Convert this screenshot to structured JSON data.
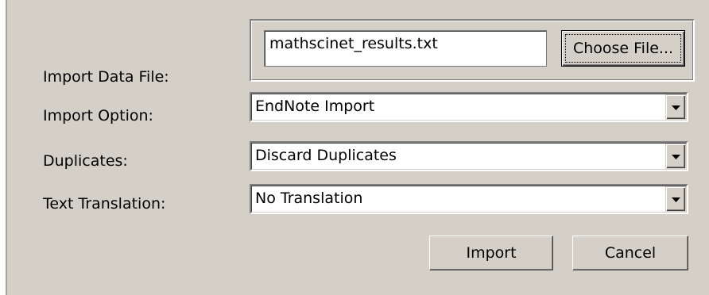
{
  "fields": {
    "import_data_file": {
      "label": "Import Data File:",
      "value": "mathscinet_results.txt",
      "choose_button": "Choose File..."
    },
    "import_option": {
      "label": "Import Option:",
      "selected": "EndNote Import"
    },
    "duplicates": {
      "label": "Duplicates:",
      "selected": "Discard Duplicates"
    },
    "text_translation": {
      "label": "Text Translation:",
      "selected": "No Translation"
    }
  },
  "buttons": {
    "import": "Import",
    "cancel": "Cancel"
  },
  "icons": {
    "dropdown": "chevron-down-icon"
  },
  "colors": {
    "dialog_background": "#d4d0c8",
    "field_background": "#ffffff"
  }
}
